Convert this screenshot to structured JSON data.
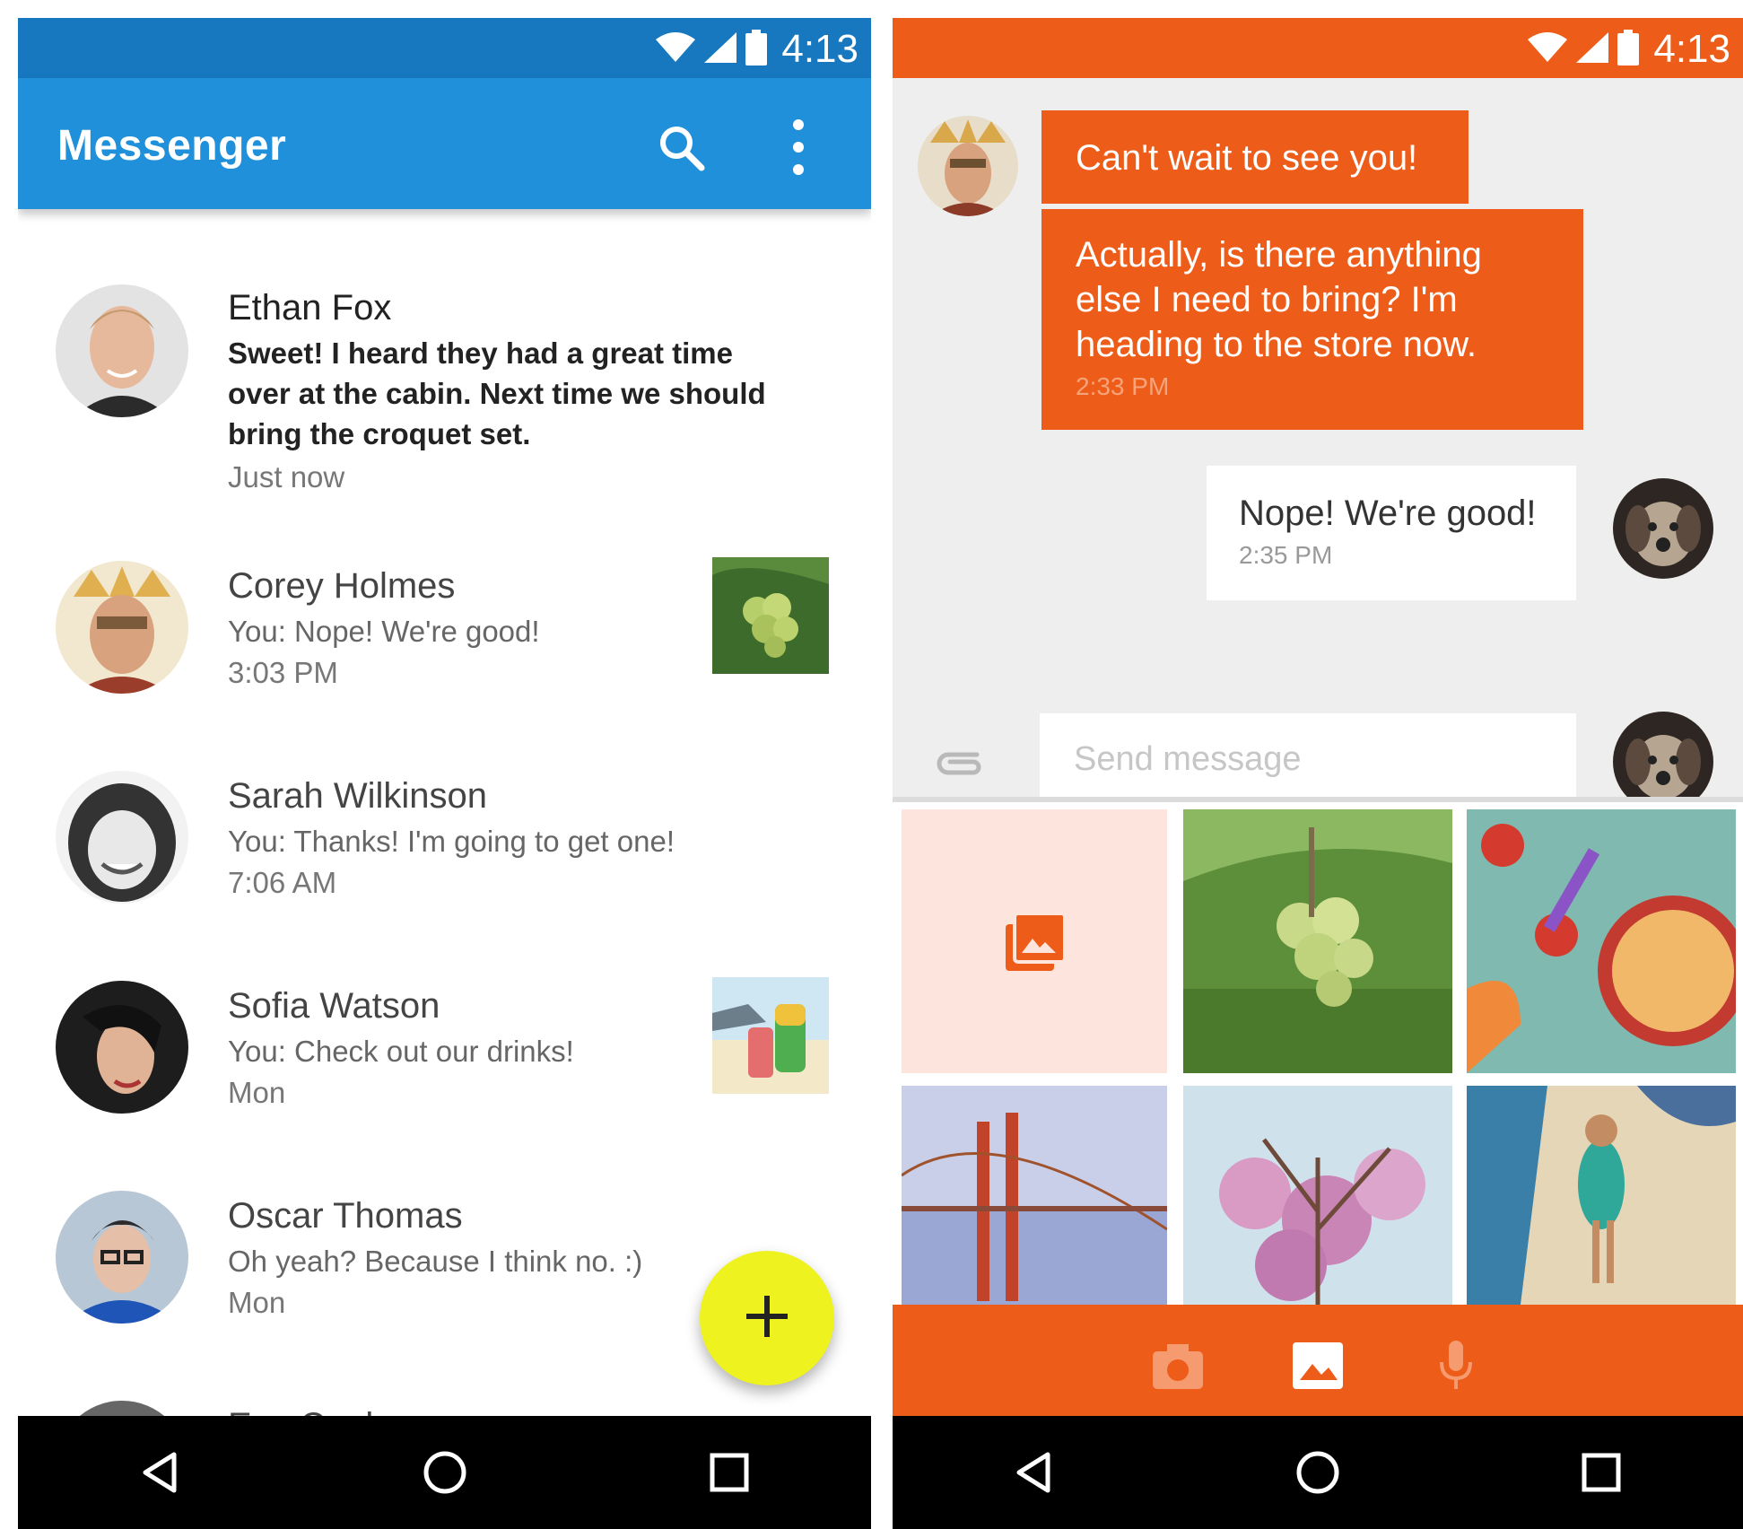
{
  "colors": {
    "messenger_primary": "#2090da",
    "messenger_status": "#1778bf",
    "conversation_accent": "#ee5c19",
    "fab": "#eef21e"
  },
  "left": {
    "status_time": "4:13",
    "app_title": "Messenger",
    "icons": [
      "wifi-icon",
      "signal-icon",
      "battery-icon",
      "search-icon",
      "more-vert-icon",
      "add-icon"
    ],
    "conversations": [
      {
        "name": "Ethan Fox",
        "snippet": "Sweet! I heard they had a great time over at the cabin. Next time we should bring the croquet set.",
        "time": "Just now",
        "unread": true,
        "thumbnail": ""
      },
      {
        "name": "Corey Holmes",
        "snippet": "You: Nope! We're good!",
        "time": "3:03 PM",
        "thumbnail": "grapes-photo"
      },
      {
        "name": "Sarah Wilkinson",
        "snippet": "You: Thanks! I'm going to get one!",
        "time": "7:06 AM",
        "thumbnail": ""
      },
      {
        "name": "Sofia Watson",
        "snippet": "You: Check out our drinks!",
        "time": "Mon",
        "thumbnail": "drinks-photo"
      },
      {
        "name": "Oscar Thomas",
        "snippet": "Oh yeah? Because I think no. :)",
        "time": "Mon",
        "thumbnail": ""
      },
      {
        "name": "Eva Cook",
        "snippet": "",
        "time": "",
        "thumbnail": ""
      }
    ]
  },
  "right": {
    "status_time": "4:13",
    "messages": [
      {
        "direction": "outgoing",
        "text": "Can't wait to see you!",
        "time": ""
      },
      {
        "direction": "outgoing",
        "text": "Actually, is there anything else I need to bring? I'm heading to the store now.",
        "time": "2:33 PM"
      },
      {
        "direction": "incoming",
        "text": "Nope! We're good!",
        "time": "2:35 PM"
      }
    ],
    "composer_placeholder": "Send message",
    "gallery": [
      "gallery-picker-icon",
      "grapes-photo",
      "fruit-picnic-photo",
      "golden-gate-bridge-photo",
      "blossom-photo",
      "beach-walk-photo"
    ],
    "media_icons": [
      "camera-icon",
      "image-icon",
      "mic-icon"
    ]
  }
}
